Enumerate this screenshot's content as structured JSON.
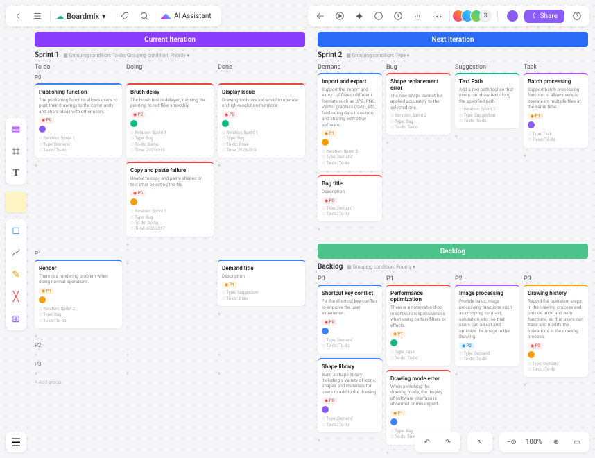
{
  "header": {
    "title": "Boardmlx",
    "ai_label": "AI Assistant",
    "share_label": "Share",
    "avatar_extra": "3"
  },
  "zoom": {
    "percent": "100%"
  },
  "boards": [
    {
      "header": "Current Iteration",
      "header_color": "hdr-purple",
      "sprint": "Sprint 1",
      "sprint_meta": "Grouping condition: To-do; Grouping condition: Priority ▾",
      "columns": [
        {
          "name": "To do"
        },
        {
          "name": "Doing"
        },
        {
          "name": "Done"
        }
      ],
      "groups": [
        {
          "prio": "P0",
          "rows": [
            [
              {
                "color": "blue",
                "title": "Publishing function",
                "body": "The publishing function allows users to post their drawings to the community and share ideas with other users.",
                "badge": "P0",
                "av": "#8b5cf6",
                "meta": [
                  "Iteration: Sprint 1",
                  "Type: Demand",
                  "To-do: To-do"
                ]
              }
            ],
            [
              {
                "color": "red",
                "title": "Brush delay",
                "body": "The brush tool is delayed, causing the painting to not flow smoothly.",
                "badge": "P0",
                "av": "#10b981",
                "meta": [
                  "Iteration: Sprint 1",
                  "Type: Bug",
                  "To-do: Doing",
                  "Time: 20230319"
                ]
              },
              {
                "color": "red",
                "title": "Copy and paste failure",
                "body": "Unable to copy and paste shapes or text after selecting the file.",
                "badge": "P0",
                "av": "#f59e0b",
                "meta": [
                  "Iteration: Sprint 1",
                  "Type: Bug",
                  "To-do: Doing",
                  "Time: 20230317"
                ]
              }
            ],
            [
              {
                "color": "red",
                "title": "Display issue",
                "body": "Drawing tools are too small to operate on high-resolution monitors.",
                "badge": "P0",
                "av": "#10b981",
                "meta": [
                  "Iteration: Sprint 1",
                  "Type: Bug",
                  "To-do: Done",
                  "Time: 20230319"
                ]
              }
            ]
          ]
        },
        {
          "prio": "P1",
          "rows": [
            [
              {
                "color": "blue",
                "title": "Render",
                "body": "There is a rendering problem when doing normal operations.",
                "badge": "P1",
                "badgecls": "p1",
                "av": "#f59e0b",
                "meta": [
                  "Iteration: Sprint 2",
                  "Type: Bug",
                  "To-do: To-do"
                ]
              }
            ],
            [],
            [
              {
                "color": "blue",
                "title": "Demand title",
                "body": "Description",
                "badge": "P1",
                "badgecls": "p1",
                "meta": [
                  "Type: Suggestion",
                  "To-do: Done"
                ]
              }
            ]
          ]
        },
        {
          "prio": "P2",
          "rows": [
            [],
            [],
            []
          ]
        },
        {
          "prio": "P3",
          "rows": [
            [],
            [],
            []
          ]
        }
      ],
      "add_group": "+ Add group"
    },
    {
      "header": "Next Iteration",
      "header_color": "hdr-blue",
      "sprint": "Sprint 2",
      "sprint_meta": "Grouping condition: Type ▾",
      "columns": [
        {
          "name": "Demand"
        },
        {
          "name": "Bug"
        },
        {
          "name": "Suggestion"
        },
        {
          "name": "Task"
        }
      ],
      "groups": [
        {
          "prio": "",
          "rows": [
            [
              {
                "color": "blue",
                "title": "Import and export",
                "body": "Support the import and export of files in different formats such as JPG, PNG, Vector graphics (SVG), etc., facilitating data transition and sharing with other software.",
                "badge": "P1",
                "badgecls": "p1",
                "av": "#f59e0b",
                "meta": [
                  "Iteration: Sprint 2",
                  "Type: Demand",
                  "To-do: To-do"
                ]
              },
              {
                "color": "red",
                "title": "Bug title",
                "body": "Description",
                "badge": "P0",
                "meta": [
                  "Type: Demand",
                  "To-do: To-do"
                ]
              }
            ],
            [
              {
                "color": "red",
                "title": "Shape replacement error",
                "body": "The new shape cannot be applied accurately to the selected one.",
                "meta": [
                  "Iteration: Sprint 2",
                  "Type: Bug",
                  "To-do: To-do"
                ]
              }
            ],
            [
              {
                "color": "green",
                "title": "Text Path",
                "body": "Add a text path tool so that users can draw text along the specified path.",
                "meta": [
                  "Iteration: Sprint 2",
                  "Type: Suggestion",
                  "To-do: To-do"
                ]
              }
            ],
            [
              {
                "color": "purple",
                "title": "Batch processing",
                "body": "Support batch processing function to allow users to operate on multiple files at the same time.",
                "badge": "P1",
                "badgecls": "p1",
                "av": "#8b5cf6",
                "meta": [
                  "Type: Task",
                  "To-do: To-do"
                ]
              }
            ]
          ]
        }
      ],
      "backlog": {
        "header": "Backlog",
        "sprint": "Backlog",
        "sprint_meta": "Grouping condition: Priority ▾",
        "columns": [
          {
            "name": "P0"
          },
          {
            "name": "P1"
          },
          {
            "name": "P2"
          },
          {
            "name": "P3"
          }
        ],
        "rows": [
          [
            {
              "color": "blue",
              "title": "Shortcut key conflict",
              "body": "Fix the shortcut key conflict to improve the user experience.",
              "badge": "P0",
              "av": "#3b82f6",
              "meta": [
                "Type: Demand",
                "To-do: To-do"
              ]
            },
            {
              "color": "blue",
              "title": "Shape library",
              "body": "Build a shape library including a variety of icons, shapes and materials for users to add to the drawing.",
              "badge": "P0",
              "av": "#8b5cf6",
              "meta": [
                "Type: Demand",
                "To-do: To-do"
              ]
            }
          ],
          [
            {
              "color": "red",
              "title": "Performance optimization",
              "body": "There is a noticeable drop in software responsiveness when using certain filters or effects.",
              "badge": "P1",
              "badgecls": "p1",
              "av": "#10b981",
              "meta": [
                "Type: Task",
                "To-do: To-do"
              ]
            },
            {
              "color": "red",
              "title": "Drawing mode error",
              "body": "When switching the drawing mode, the display of software interface is abnormal or misaligned.",
              "badge": "P1",
              "badgecls": "p1",
              "av": "#3b82f6",
              "meta": [
                "Type: Bug",
                "To-do: To-do"
              ]
            }
          ],
          [
            {
              "color": "purple",
              "title": "Image processing",
              "body": "Provide basic image processing functions such as cropping, contrast, saturation, etc., so that users can adjust and optimize the image in the drawing.",
              "badge": "P2",
              "badgecls": "p2",
              "meta": [
                "Type: Demand",
                "To-do: To-do"
              ]
            }
          ],
          [
            {
              "color": "orange",
              "title": "Drawing history",
              "body": "Record the operation steps in the drawing process and provide undo and redo functions, so that users can trace and modify the operations in the drawing process.",
              "badge": "P3",
              "av": "#f59e0b",
              "meta": [
                "Type: Demand",
                "To-do: To-do"
              ]
            }
          ]
        ]
      }
    }
  ]
}
